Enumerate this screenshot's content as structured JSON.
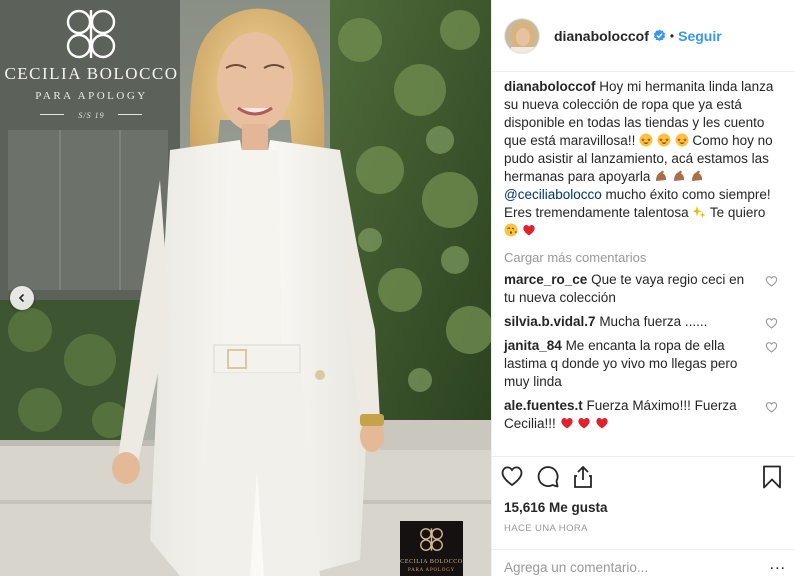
{
  "photo": {
    "brand_name": "CECILIA BOLOCCO",
    "brand_sub": "PARA APOLOGY",
    "brand_season": "S/S 19",
    "stamp_name": "CECILIA BOLOCCO",
    "stamp_sub": "PARA APOLOGY",
    "carousel_prev_icon": "chevron-left-icon"
  },
  "header": {
    "username": "dianaboloccof",
    "verified_icon": "verified-badge-icon",
    "separator": "•",
    "follow_label": "Seguir"
  },
  "caption": {
    "username": "dianaboloccof",
    "text_1": "Hoy mi hermanita linda lanza su nueva colección de ropa que ya está disponible en todas las tiendas y les cuento que está maravillosa!!",
    "text_2": "Como hoy no pudo asistir al lanzamiento, acá estamos las hermanas para apoyarla",
    "mention": "@ceciliabolocco",
    "text_3": "mucho éxito como siempre! Eres tremendamente talentosa",
    "text_4": "Te quiero"
  },
  "load_more_label": "Cargar más comentarios",
  "comments": [
    {
      "user": "marce_ro_ce",
      "text": "Que te vaya regio ceci en tu nueva colección"
    },
    {
      "user": "silvia.b.vidal.7",
      "text": "Mucha fuerza ......"
    },
    {
      "user": "janita_84",
      "text": "Me encanta la ropa de ella lastima q donde yo vivo mo llegas pero muy linda"
    },
    {
      "user": "ale.fuentes.t",
      "text": "Fuerza Máximo!!! Fuerza Cecilia!!!"
    }
  ],
  "likes_text": "15,616 Me gusta",
  "time_ago": "HACE UNA HORA",
  "add_comment": {
    "placeholder": "Agrega un comentario...",
    "more_label": "..."
  },
  "colors": {
    "link": "#3897f0",
    "muted": "#999999",
    "text": "#262626",
    "heart": "#ed4956"
  }
}
